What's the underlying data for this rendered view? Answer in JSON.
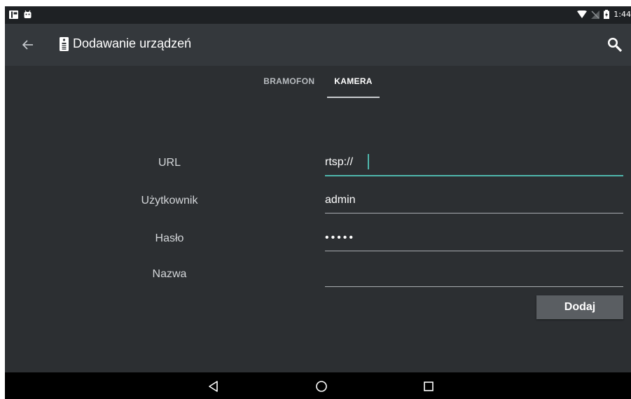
{
  "status_bar": {
    "time": "1:44",
    "icons": [
      "notification-icon",
      "android-icon",
      "wifi-icon",
      "no-signal-icon",
      "battery-icon"
    ]
  },
  "app_bar": {
    "title": "Dodawanie urządzeń",
    "back_icon": "arrow-back-icon",
    "device_icon": "intercom-device-icon",
    "search_icon": "search-icon"
  },
  "tabs": [
    {
      "label": "BRAMOFON",
      "active": false
    },
    {
      "label": "KAMERA",
      "active": true
    }
  ],
  "form": {
    "url": {
      "label": "URL",
      "value": "rtsp://"
    },
    "user": {
      "label": "Użytkownik",
      "value": "admin"
    },
    "password": {
      "label": "Hasło",
      "value": "•••••"
    },
    "name": {
      "label": "Nazwa",
      "value": ""
    }
  },
  "add_button": {
    "label": "Dodaj"
  },
  "nav_bar": {
    "back": "back-triangle-icon",
    "home": "home-circle-icon",
    "recents": "recents-square-icon"
  },
  "colors": {
    "accent": "#4fb7ad",
    "background": "#2c2f32",
    "appbar": "#34383c"
  }
}
